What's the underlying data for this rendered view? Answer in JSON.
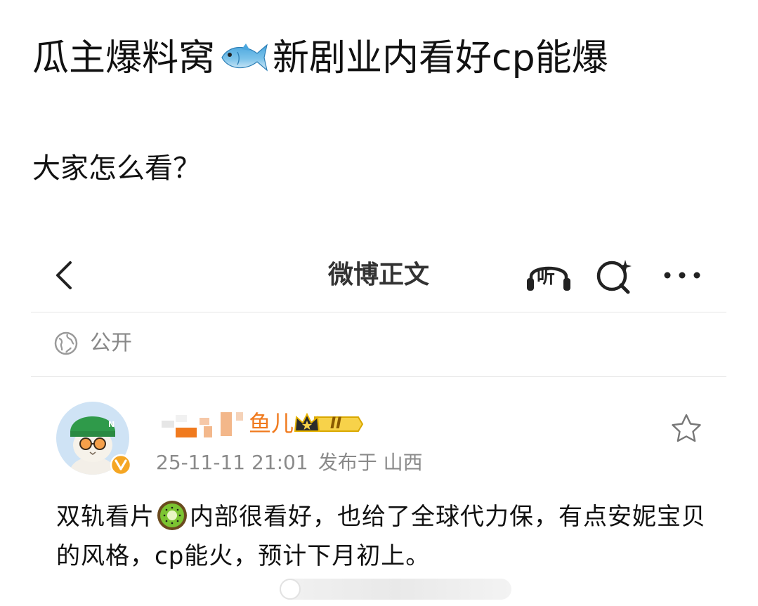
{
  "post": {
    "title_before": "瓜主爆料窝",
    "title_emoji": "fish-emoji",
    "title_after": "新剧业内看好cp能爆",
    "body": "大家怎么看？"
  },
  "weibo": {
    "nav": {
      "title": "微博正文",
      "listen_label": "听",
      "icons": [
        "back-chevron-icon",
        "listen-headphones-icon",
        "search-sparkle-icon",
        "more-dots-icon"
      ]
    },
    "privacy": {
      "label": "公开",
      "icon": "globe-icon"
    },
    "author": {
      "name_visible": "鱼儿",
      "badge_level": "II",
      "badge_icon": "crown-icon",
      "verified_icon": "verified-v-icon",
      "time": "25-11-11 21:01",
      "location": "发布于 山西"
    },
    "content": {
      "text_part1": "双轨看片",
      "emoji": "kiwi-emoji",
      "text_part2": "内部很看好，也给了全球代力保，有点安妮宝贝的风格，cp能火，预计下月初上。"
    },
    "colors": {
      "username": "#f07a1e",
      "crown_gold": "#e8b400",
      "verified": "#f5a623",
      "divider": "#e6e6e6",
      "meta_gray": "#8a8a8a"
    }
  }
}
